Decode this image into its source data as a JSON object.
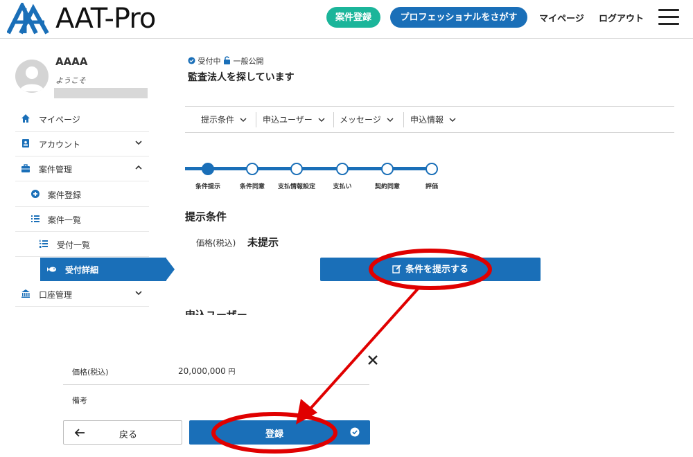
{
  "header": {
    "logo_text": "AAT-Pro",
    "register_button": "案件登録",
    "find_pro_button": "プロフェッショナルをさがす",
    "mypage_link": "マイページ",
    "logout_link": "ログアウト"
  },
  "user": {
    "name": "AAAA",
    "welcome": "ようこそ"
  },
  "sidebar": {
    "items": [
      {
        "label": "マイページ",
        "icon": "home-icon"
      },
      {
        "label": "アカウント",
        "icon": "account-icon"
      },
      {
        "label": "案件管理",
        "icon": "briefcase-icon"
      },
      {
        "label": "案件登録",
        "icon": "plus-circle-icon"
      },
      {
        "label": "案件一覧",
        "icon": "list-icon"
      },
      {
        "label": "受付一覧",
        "icon": "ordered-list-icon"
      },
      {
        "label": "受付詳細",
        "icon": "fish-icon"
      },
      {
        "label": "口座管理",
        "icon": "bank-icon"
      }
    ]
  },
  "main": {
    "status_accepting": "受付中",
    "status_public": "一般公開",
    "title": "監査法人を探しています",
    "tabs": [
      "提示条件",
      "申込ユーザー",
      "メッセージ",
      "申込情報"
    ],
    "steps": [
      "条件提示",
      "条件同意",
      "支払情報設定",
      "支払い",
      "契約同意",
      "評価"
    ],
    "current_step": 1,
    "section_title": "提示条件",
    "price_label": "価格(税込)",
    "price_value": "未提示",
    "present_button": "条件を提示する",
    "next_section_cut": "申込ユーザー"
  },
  "modal": {
    "price_label": "価格(税込)",
    "price_value": "20,000,000",
    "price_unit": "円",
    "note_label": "備考",
    "back_button": "戻る",
    "register_button": "登録"
  },
  "colors": {
    "primary": "#1a6fb8",
    "teal": "#1bb59a",
    "annotation": "#e00000"
  }
}
